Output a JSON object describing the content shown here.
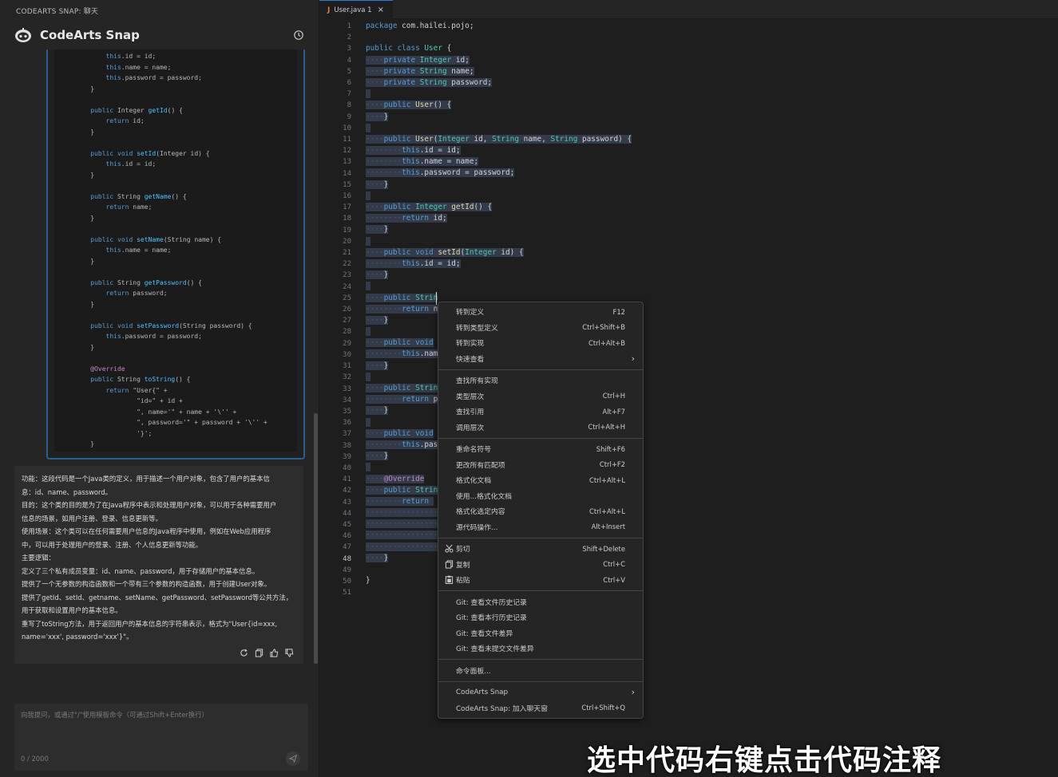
{
  "panel": {
    "title": "CODEARTS SNAP: 聊天",
    "brand": "CodeArts Snap",
    "brand_icon": "robot-logo-icon",
    "history_icon": "history-icon"
  },
  "chat_code": [
    "        this.id = id;",
    "        this.name = name;",
    "        this.password = password;",
    "    }",
    "",
    "    public Integer getId() {",
    "        return id;",
    "    }",
    "",
    "    public void setId(Integer id) {",
    "        this.id = id;",
    "    }",
    "",
    "    public String getName() {",
    "        return name;",
    "    }",
    "",
    "    public void setName(String name) {",
    "        this.name = name;",
    "    }",
    "",
    "    public String getPassword() {",
    "        return password;",
    "    }",
    "",
    "    public void setPassword(String password) {",
    "        this.password = password;",
    "    }",
    "",
    "    @Override",
    "    public String toString() {",
    "        return \"User{\" +",
    "                \"id=\" + id +",
    "                \", name='\" + name + '\\'' +",
    "                \", password='\" + password + '\\'' +",
    "                '}';",
    "    }"
  ],
  "answer": {
    "lines": [
      "功能：这段代码是一个Java类的定义，用于描述一个用户对象，包含了用户的基本信",
      "息：id、name、password。",
      "目的：这个类的目的是为了在Java程序中表示和处理用户对象，可以用于各种需要用户",
      "信息的场景，如用户注册、登录、信息更新等。",
      "使用场景：这个类可以在任何需要用户信息的Java程序中使用，例如在Web应用程序",
      "中，可以用于处理用户的登录、注册、个人信息更新等功能。",
      "主要逻辑：",
      "定义了三个私有成员变量：id、name、password，用于存储用户的基本信息。",
      "提供了一个无参数的构造函数和一个带有三个参数的构造函数，用于创建User对象。",
      "提供了getId、setId、getname、setName、getPassword、setPassword等公共方法，",
      "用于获取和设置用户的基本信息。",
      "重写了toString方法，用于返回用户的基本信息的字符串表示，格式为\"User{id=xxx,",
      "name='xxx', password='xxx'}\"。"
    ],
    "actions": [
      "refresh-icon",
      "copy-icon",
      "thumbs-up-icon",
      "thumbs-down-icon"
    ]
  },
  "input": {
    "placeholder": "向我提问，或通过\"/\"使用模板命令（可通过Shift+Enter换行）",
    "counter": "0 / 2000",
    "send_icon": "send-icon"
  },
  "tab": {
    "label": "User.java",
    "badge": "1",
    "java_icon": "J",
    "close": "×"
  },
  "editor": {
    "line_numbers": [
      "1",
      "2",
      "3",
      "4",
      "5",
      "6",
      "7",
      "8",
      "9",
      "10",
      "11",
      "12",
      "13",
      "14",
      "15",
      "16",
      "17",
      "18",
      "19",
      "20",
      "21",
      "22",
      "23",
      "24",
      "25",
      "26",
      "27",
      "28",
      "29",
      "30",
      "31",
      "32",
      "33",
      "34",
      "35",
      "36",
      "37",
      "38",
      "39",
      "40",
      "41",
      "42",
      "43",
      "44",
      "45",
      "46",
      "47",
      "48",
      "49",
      "50",
      "51"
    ],
    "current_line": "48"
  },
  "context_menu": {
    "items": [
      {
        "label": "转到定义",
        "key": "F12"
      },
      {
        "label": "转到类型定义",
        "key": "Ctrl+Shift+B"
      },
      {
        "label": "转到实现",
        "key": "Ctrl+Alt+B"
      },
      {
        "label": "快速查看",
        "key": "",
        "submenu": true
      },
      {
        "separator": true
      },
      {
        "label": "查找所有实现",
        "key": ""
      },
      {
        "label": "类型层次",
        "key": "Ctrl+H"
      },
      {
        "label": "查找引用",
        "key": "Alt+F7"
      },
      {
        "label": "调用层次",
        "key": "Ctrl+Alt+H"
      },
      {
        "separator": true
      },
      {
        "label": "重命名符号",
        "key": "Shift+F6"
      },
      {
        "label": "更改所有匹配项",
        "key": "Ctrl+F2"
      },
      {
        "label": "格式化文档",
        "key": "Ctrl+Alt+L"
      },
      {
        "label": "使用...格式化文档",
        "key": ""
      },
      {
        "label": "格式化选定内容",
        "key": "Ctrl+Alt+L"
      },
      {
        "label": "源代码操作...",
        "key": "Alt+Insert"
      },
      {
        "separator": true
      },
      {
        "label": "剪切",
        "key": "Shift+Delete",
        "icon": "scissors-icon"
      },
      {
        "label": "复制",
        "key": "Ctrl+C",
        "icon": "copy-icon"
      },
      {
        "label": "粘贴",
        "key": "Ctrl+V",
        "icon": "paste-icon"
      },
      {
        "separator": true
      },
      {
        "label": "Git: 查看文件历史记录",
        "key": ""
      },
      {
        "label": "Git: 查看本行历史记录",
        "key": ""
      },
      {
        "label": "Git: 查看文件差异",
        "key": ""
      },
      {
        "label": "Git: 查看未提交文件差异",
        "key": ""
      },
      {
        "separator": true
      },
      {
        "label": "命令面板...",
        "key": ""
      },
      {
        "separator": true
      },
      {
        "label": "CodeArts Snap",
        "key": "",
        "submenu": true
      },
      {
        "label": "CodeArts Snap: 加入聊天窗",
        "key": "Ctrl+Shift+Q"
      }
    ]
  },
  "caption": "选中代码右键点击代码注释"
}
